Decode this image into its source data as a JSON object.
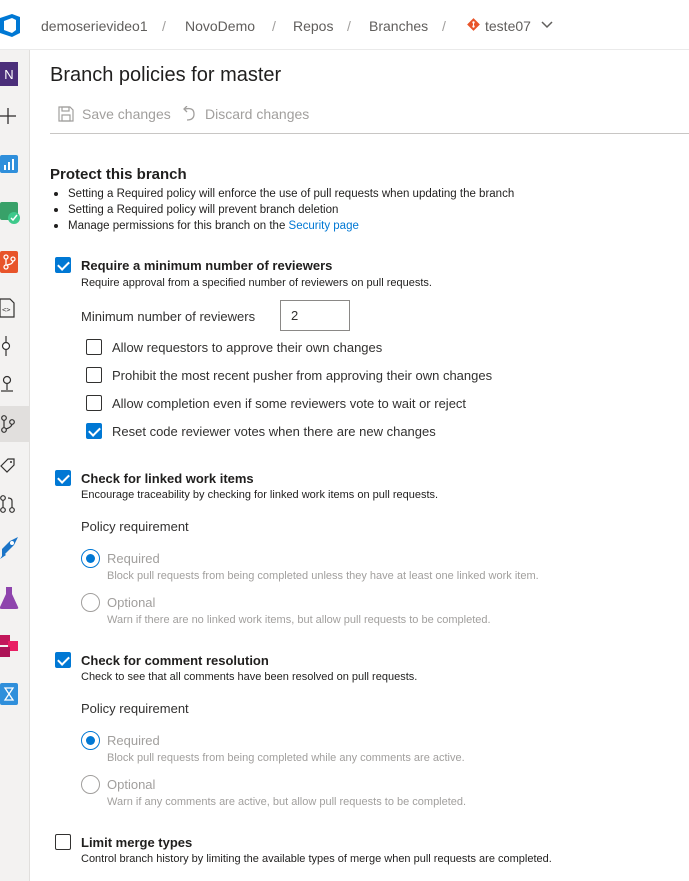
{
  "breadcrumb": {
    "org": "demoserievideo1",
    "project": "NovoDemo",
    "repos": "Repos",
    "branches": "Branches",
    "branch": "teste07",
    "separator": "/"
  },
  "rail": {
    "project_badge": "N"
  },
  "page": {
    "title": "Branch policies for master",
    "save_label": "Save changes",
    "discard_label": "Discard changes"
  },
  "protect": {
    "heading": "Protect this branch",
    "bullet1": "Setting a Required policy will enforce the use of pull requests when updating the branch",
    "bullet2": "Setting a Required policy will prevent branch deletion",
    "bullet3_prefix": "Manage permissions for this branch on the ",
    "bullet3_link": "Security page"
  },
  "reviewers": {
    "checked": true,
    "title": "Require a minimum number of reviewers",
    "description": "Require approval from a specified number of reviewers on pull requests.",
    "min_label": "Minimum number of reviewers",
    "min_value": "2",
    "options": [
      {
        "label": "Allow requestors to approve their own changes",
        "checked": false
      },
      {
        "label": "Prohibit the most recent pusher from approving their own changes",
        "checked": false
      },
      {
        "label": "Allow completion even if some reviewers vote to wait or reject",
        "checked": false
      },
      {
        "label": "Reset code reviewer votes when there are new changes",
        "checked": true
      }
    ]
  },
  "work_items": {
    "checked": true,
    "title": "Check for linked work items",
    "description": "Encourage traceability by checking for linked work items on pull requests.",
    "requirement_label": "Policy requirement",
    "required_label": "Required",
    "required_desc": "Block pull requests from being completed unless they have at least one linked work item.",
    "optional_label": "Optional",
    "optional_desc": "Warn if there are no linked work items, but allow pull requests to be completed.",
    "selected": "Required"
  },
  "comments": {
    "checked": true,
    "title": "Check for comment resolution",
    "description": "Check to see that all comments have been resolved on pull requests.",
    "requirement_label": "Policy requirement",
    "required_label": "Required",
    "required_desc": "Block pull requests from being completed while any comments are active.",
    "optional_label": "Optional",
    "optional_desc": "Warn if any comments are active, but allow pull requests to be completed.",
    "selected": "Required"
  },
  "merge": {
    "checked": false,
    "title": "Limit merge types",
    "description": "Control branch history by limiting the available types of merge when pull requests are completed."
  },
  "colors": {
    "accent": "#0078d4",
    "branch_icon": "#e8542a"
  }
}
